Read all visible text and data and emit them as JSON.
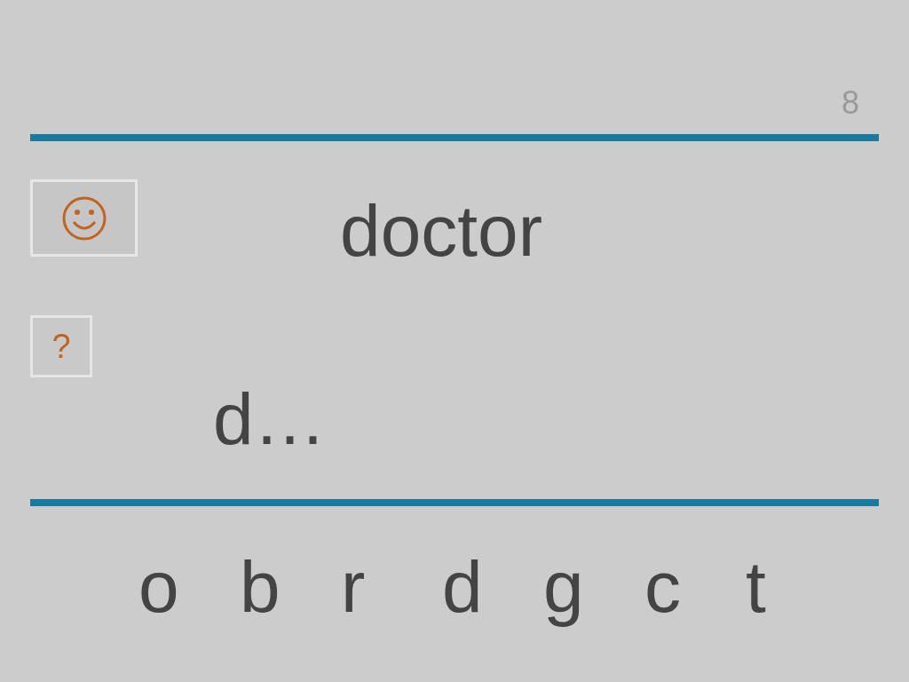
{
  "counter": "8",
  "word": "doctor",
  "hint_button": "?",
  "answer": "d…",
  "letters": [
    "o",
    "b",
    "r",
    "d",
    "g",
    "c",
    "t"
  ]
}
